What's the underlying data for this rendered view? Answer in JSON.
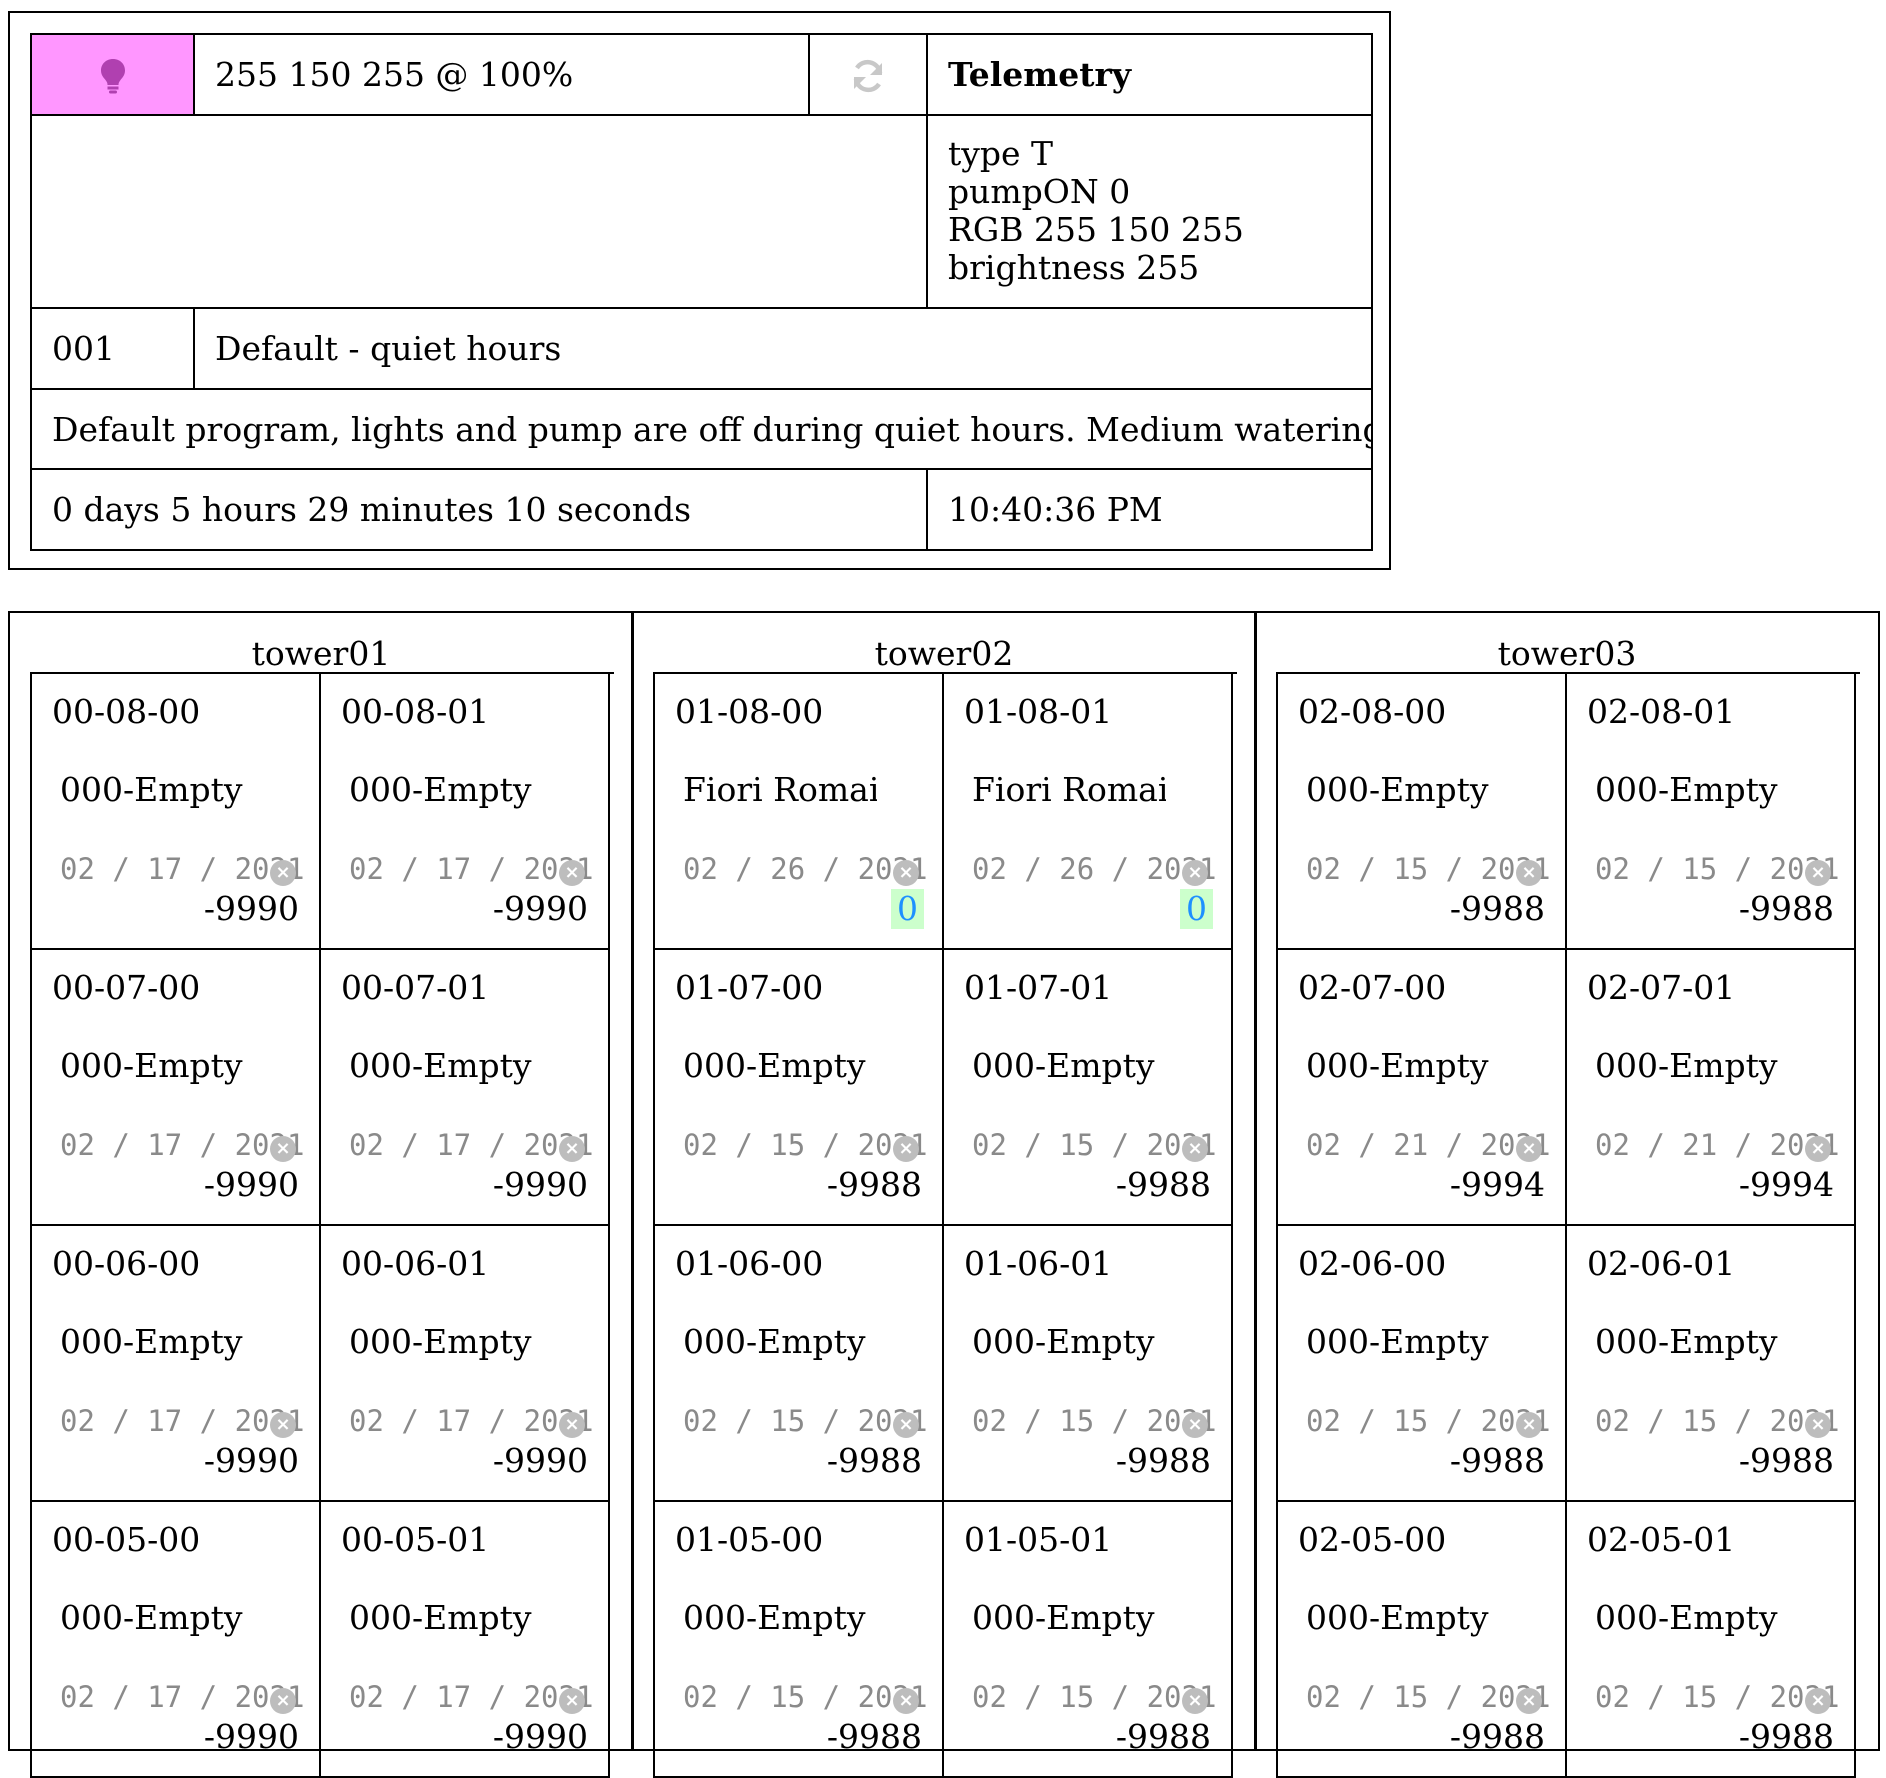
{
  "status": {
    "color_swatch": "#ff96ff",
    "bulb_icon": "lightbulb-icon",
    "color_readout": "255 150 255 @ 100%",
    "refresh_icon": "refresh-icon",
    "telemetry_title": "Telemetry",
    "telemetry_lines": [
      "type T",
      "pumpON 0",
      "RGB 255 150 255",
      "brightness 255"
    ],
    "program_number": "001",
    "program_name": "Default - quiet hours",
    "program_description": "Default program, lights and pump are off during quiet hours. Medium watering",
    "uptime": "0 days 5 hours 29 minutes 10 seconds",
    "clock": "10:40:36 PM"
  },
  "towers": [
    {
      "name": "tower01",
      "slots": [
        {
          "id": "00-08-00",
          "plant": "000-Empty",
          "date": "02 / 17 / 2021",
          "value": "-9990"
        },
        {
          "id": "00-08-01",
          "plant": "000-Empty",
          "date": "02 / 17 / 2021",
          "value": "-9990"
        },
        {
          "id": "00-07-00",
          "plant": "000-Empty",
          "date": "02 / 17 / 2021",
          "value": "-9990"
        },
        {
          "id": "00-07-01",
          "plant": "000-Empty",
          "date": "02 / 17 / 2021",
          "value": "-9990"
        },
        {
          "id": "00-06-00",
          "plant": "000-Empty",
          "date": "02 / 17 / 2021",
          "value": "-9990"
        },
        {
          "id": "00-06-01",
          "plant": "000-Empty",
          "date": "02 / 17 / 2021",
          "value": "-9990"
        },
        {
          "id": "00-05-00",
          "plant": "000-Empty",
          "date": "02 / 17 / 2021",
          "value": "-9990"
        },
        {
          "id": "00-05-01",
          "plant": "000-Empty",
          "date": "02 / 17 / 2021",
          "value": "-9990"
        }
      ]
    },
    {
      "name": "tower02",
      "slots": [
        {
          "id": "01-08-00",
          "plant": "Fiori Romai",
          "date": "02 / 26 / 2021",
          "value": "0",
          "highlight": true
        },
        {
          "id": "01-08-01",
          "plant": "Fiori Romai",
          "date": "02 / 26 / 2021",
          "value": "0",
          "highlight": true
        },
        {
          "id": "01-07-00",
          "plant": "000-Empty",
          "date": "02 / 15 / 2021",
          "value": "-9988"
        },
        {
          "id": "01-07-01",
          "plant": "000-Empty",
          "date": "02 / 15 / 2021",
          "value": "-9988"
        },
        {
          "id": "01-06-00",
          "plant": "000-Empty",
          "date": "02 / 15 / 2021",
          "value": "-9988"
        },
        {
          "id": "01-06-01",
          "plant": "000-Empty",
          "date": "02 / 15 / 2021",
          "value": "-9988"
        },
        {
          "id": "01-05-00",
          "plant": "000-Empty",
          "date": "02 / 15 / 2021",
          "value": "-9988"
        },
        {
          "id": "01-05-01",
          "plant": "000-Empty",
          "date": "02 / 15 / 2021",
          "value": "-9988"
        }
      ]
    },
    {
      "name": "tower03",
      "slots": [
        {
          "id": "02-08-00",
          "plant": "000-Empty",
          "date": "02 / 15 / 2021",
          "value": "-9988"
        },
        {
          "id": "02-08-01",
          "plant": "000-Empty",
          "date": "02 / 15 / 2021",
          "value": "-9988"
        },
        {
          "id": "02-07-00",
          "plant": "000-Empty",
          "date": "02 / 21 / 2021",
          "value": "-9994"
        },
        {
          "id": "02-07-01",
          "plant": "000-Empty",
          "date": "02 / 21 / 2021",
          "value": "-9994"
        },
        {
          "id": "02-06-00",
          "plant": "000-Empty",
          "date": "02 / 15 / 2021",
          "value": "-9988"
        },
        {
          "id": "02-06-01",
          "plant": "000-Empty",
          "date": "02 / 15 / 2021",
          "value": "-9988"
        },
        {
          "id": "02-05-00",
          "plant": "000-Empty",
          "date": "02 / 15 / 2021",
          "value": "-9988"
        },
        {
          "id": "02-05-01",
          "plant": "000-Empty",
          "date": "02 / 15 / 2021",
          "value": "-9988"
        }
      ]
    }
  ]
}
